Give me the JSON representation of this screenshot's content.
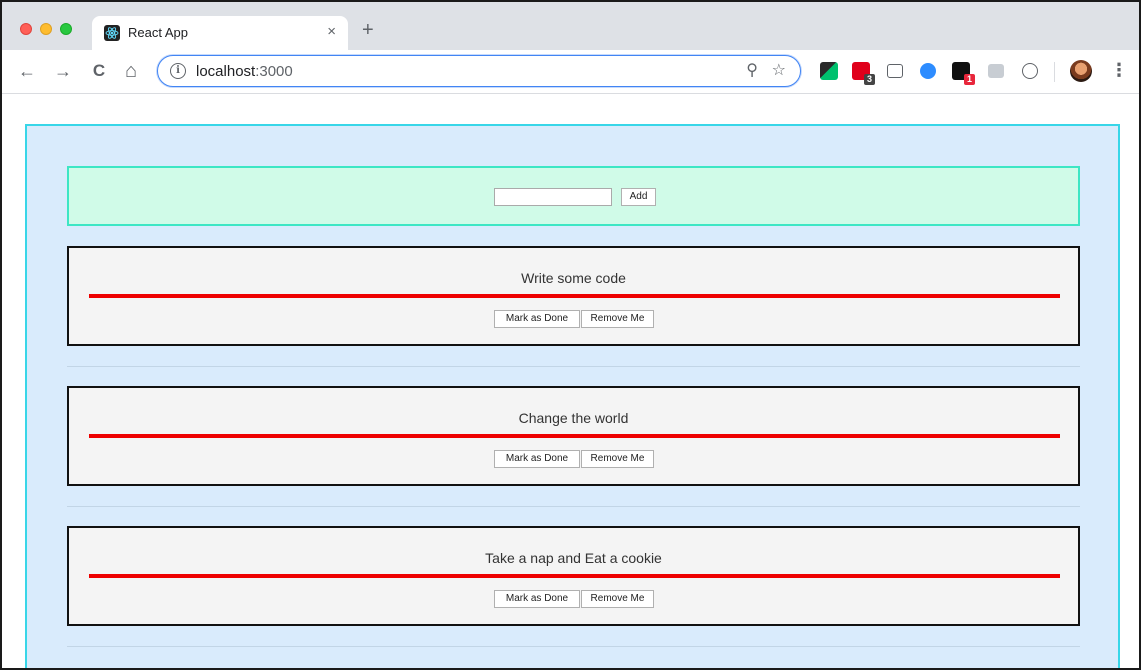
{
  "browser": {
    "tab_title": "React App",
    "tab_close": "×",
    "new_tab": "+",
    "url_host": "localhost",
    "url_port": ":3000",
    "info_glyph": "i",
    "zoom_glyph": "⚲",
    "star_glyph": "☆",
    "back_glyph": "←",
    "forward_glyph": "→",
    "reload_glyph": "C",
    "home_glyph": "⌂",
    "menu_glyph": "⋮",
    "extensions": [
      {
        "name": "eyedropper-icon",
        "badge": ""
      },
      {
        "name": "todoist-icon",
        "badge": "3"
      },
      {
        "name": "cast-icon",
        "badge": ""
      },
      {
        "name": "zoom-icon",
        "badge": ""
      },
      {
        "name": "amazon-icon",
        "badge": "1"
      },
      {
        "name": "css-icon",
        "badge": ""
      },
      {
        "name": "code-icon",
        "badge": ""
      }
    ],
    "colors": {
      "accent": "#4285f4",
      "tabstrip": "#dee1e6"
    }
  },
  "form": {
    "input_value": "",
    "add_label": "Add"
  },
  "todos": [
    {
      "text": "Write some code",
      "done_label": "Mark as Done",
      "remove_label": "Remove Me"
    },
    {
      "text": "Change the world",
      "done_label": "Mark as Done",
      "remove_label": "Remove Me"
    },
    {
      "text": "Take a nap and Eat a cookie",
      "done_label": "Mark as Done",
      "remove_label": "Remove Me"
    }
  ],
  "colors": {
    "app_bg": "#d9ebfc",
    "app_border": "#38d6e8",
    "form_bg": "#d0fbe8",
    "form_border": "#3de6c4",
    "strike": "#ee0000"
  }
}
